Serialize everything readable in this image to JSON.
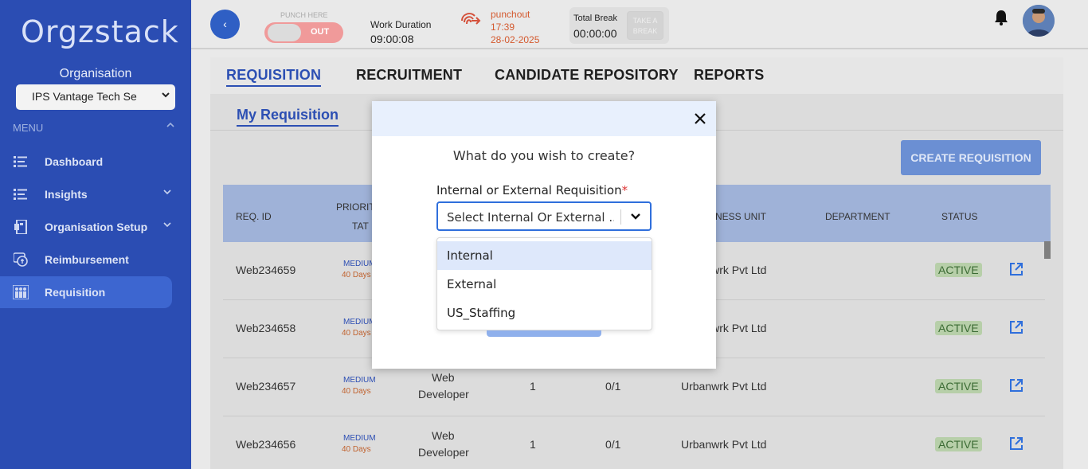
{
  "sidebar": {
    "logo": "Orgzstack",
    "org_label": "Organisation",
    "org_selected": "IPS Vantage Tech Se",
    "menu_label": "MENU",
    "items": [
      {
        "label": "Dashboard",
        "icon": "list-icon"
      },
      {
        "label": "Insights",
        "icon": "list-icon"
      },
      {
        "label": "Organisation Setup",
        "icon": "building-icon"
      },
      {
        "label": "Reimbursement",
        "icon": "reimbursement-icon"
      },
      {
        "label": "Requisition",
        "icon": "people-icon"
      }
    ]
  },
  "header": {
    "punch_here": "PUNCH HERE",
    "punch_state": "OUT",
    "work_duration_label": "Work Duration",
    "work_duration": "09:00:08",
    "punchout_label": "punchout",
    "punchout_time": "17:39",
    "punchout_date": "28-02-2025",
    "total_break_label": "Total Break",
    "total_break": "00:00:00",
    "take_break": "TAKE A BREAK"
  },
  "tabs": [
    "REQUISITION",
    "RECRUITMENT",
    "CANDIDATE REPOSITORY",
    "REPORTS"
  ],
  "subtab": "My Requisition",
  "create_button": "CREATE REQUISITION",
  "table": {
    "headers": [
      "REQ. ID",
      "PRIORITY",
      "TAT",
      "BUSINESS UNIT",
      "DEPARTMENT",
      "STATUS"
    ],
    "rows": [
      {
        "id": "Web234659",
        "priority": "MEDIUM",
        "tat": "40 Days",
        "role": "",
        "positions": "",
        "filled": "",
        "unit": "Urbanwrk Pvt Ltd",
        "status": "ACTIVE"
      },
      {
        "id": "Web234658",
        "priority": "MEDIUM",
        "tat": "40 Days",
        "role": "",
        "positions": "",
        "filled": "",
        "unit": "Urbanwrk Pvt Ltd",
        "status": "ACTIVE"
      },
      {
        "id": "Web234657",
        "priority": "MEDIUM",
        "tat": "40 Days",
        "role_line1": "Web",
        "role_line2": "Developer",
        "positions": "1",
        "filled": "0/1",
        "unit": "Urbanwrk Pvt Ltd",
        "status": "ACTIVE"
      },
      {
        "id": "Web234656",
        "priority": "MEDIUM",
        "tat": "40 Days",
        "role_line1": "Web",
        "role_line2": "Developer",
        "positions": "1",
        "filled": "0/1",
        "unit": "Urbanwrk Pvt Ltd",
        "status": "ACTIVE"
      }
    ]
  },
  "modal": {
    "question": "What do you wish to create?",
    "field_label": "Internal or External Requisition",
    "required_mark": "*",
    "placeholder": "Select Internal Or External ...",
    "options": [
      "Internal",
      "External",
      "US_Staffing"
    ]
  }
}
